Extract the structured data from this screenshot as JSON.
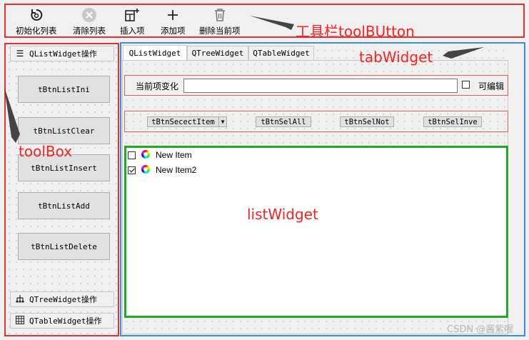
{
  "toolbar": {
    "buttons": [
      {
        "label": "初始化列表",
        "icon": "refresh-icon"
      },
      {
        "label": "清除列表",
        "icon": "clear-icon"
      },
      {
        "label": "插入项",
        "icon": "insert-icon"
      },
      {
        "label": "添加项",
        "icon": "plus-icon"
      },
      {
        "label": "删除当前项",
        "icon": "trash-icon"
      }
    ],
    "annotation": "工具栏toolBUtton"
  },
  "toolbox": {
    "annotation": "toolBox",
    "pages": [
      {
        "label": "QListWidget操作",
        "icon": "menu-icon"
      },
      {
        "label": "QTreeWidget操作",
        "icon": "tree-icon"
      },
      {
        "label": "QTableWidget操作",
        "icon": "table-icon"
      }
    ],
    "buttons": [
      "tBtnListIni",
      "tBtnListClear",
      "tBtnListInsert",
      "tBtnListAdd",
      "tBtnListDelete"
    ]
  },
  "tabs": {
    "annotation": "tabWidget",
    "items": [
      "QListWidget",
      "QTreeWidget",
      "QTableWidget"
    ],
    "active_index": 0
  },
  "editor": {
    "label": "当前项变化",
    "value": "",
    "editable_label": "可编辑",
    "editable_checked": false
  },
  "selection_buttons": [
    "tBtnSecectItem",
    "tBtnSelAll",
    "tBtnSelNot",
    "tBtnSelInve"
  ],
  "list": {
    "annotation": "listWidget",
    "items": [
      {
        "label": "New Item",
        "checked": false
      },
      {
        "label": "New Item2",
        "checked": true
      }
    ]
  },
  "watermark": "CSDN @酱紫喔",
  "colors": {
    "annotation_red": "#ff2020",
    "frame_red": "#e83030",
    "frame_blue": "#3a8ee8",
    "frame_green": "#22aa22"
  }
}
